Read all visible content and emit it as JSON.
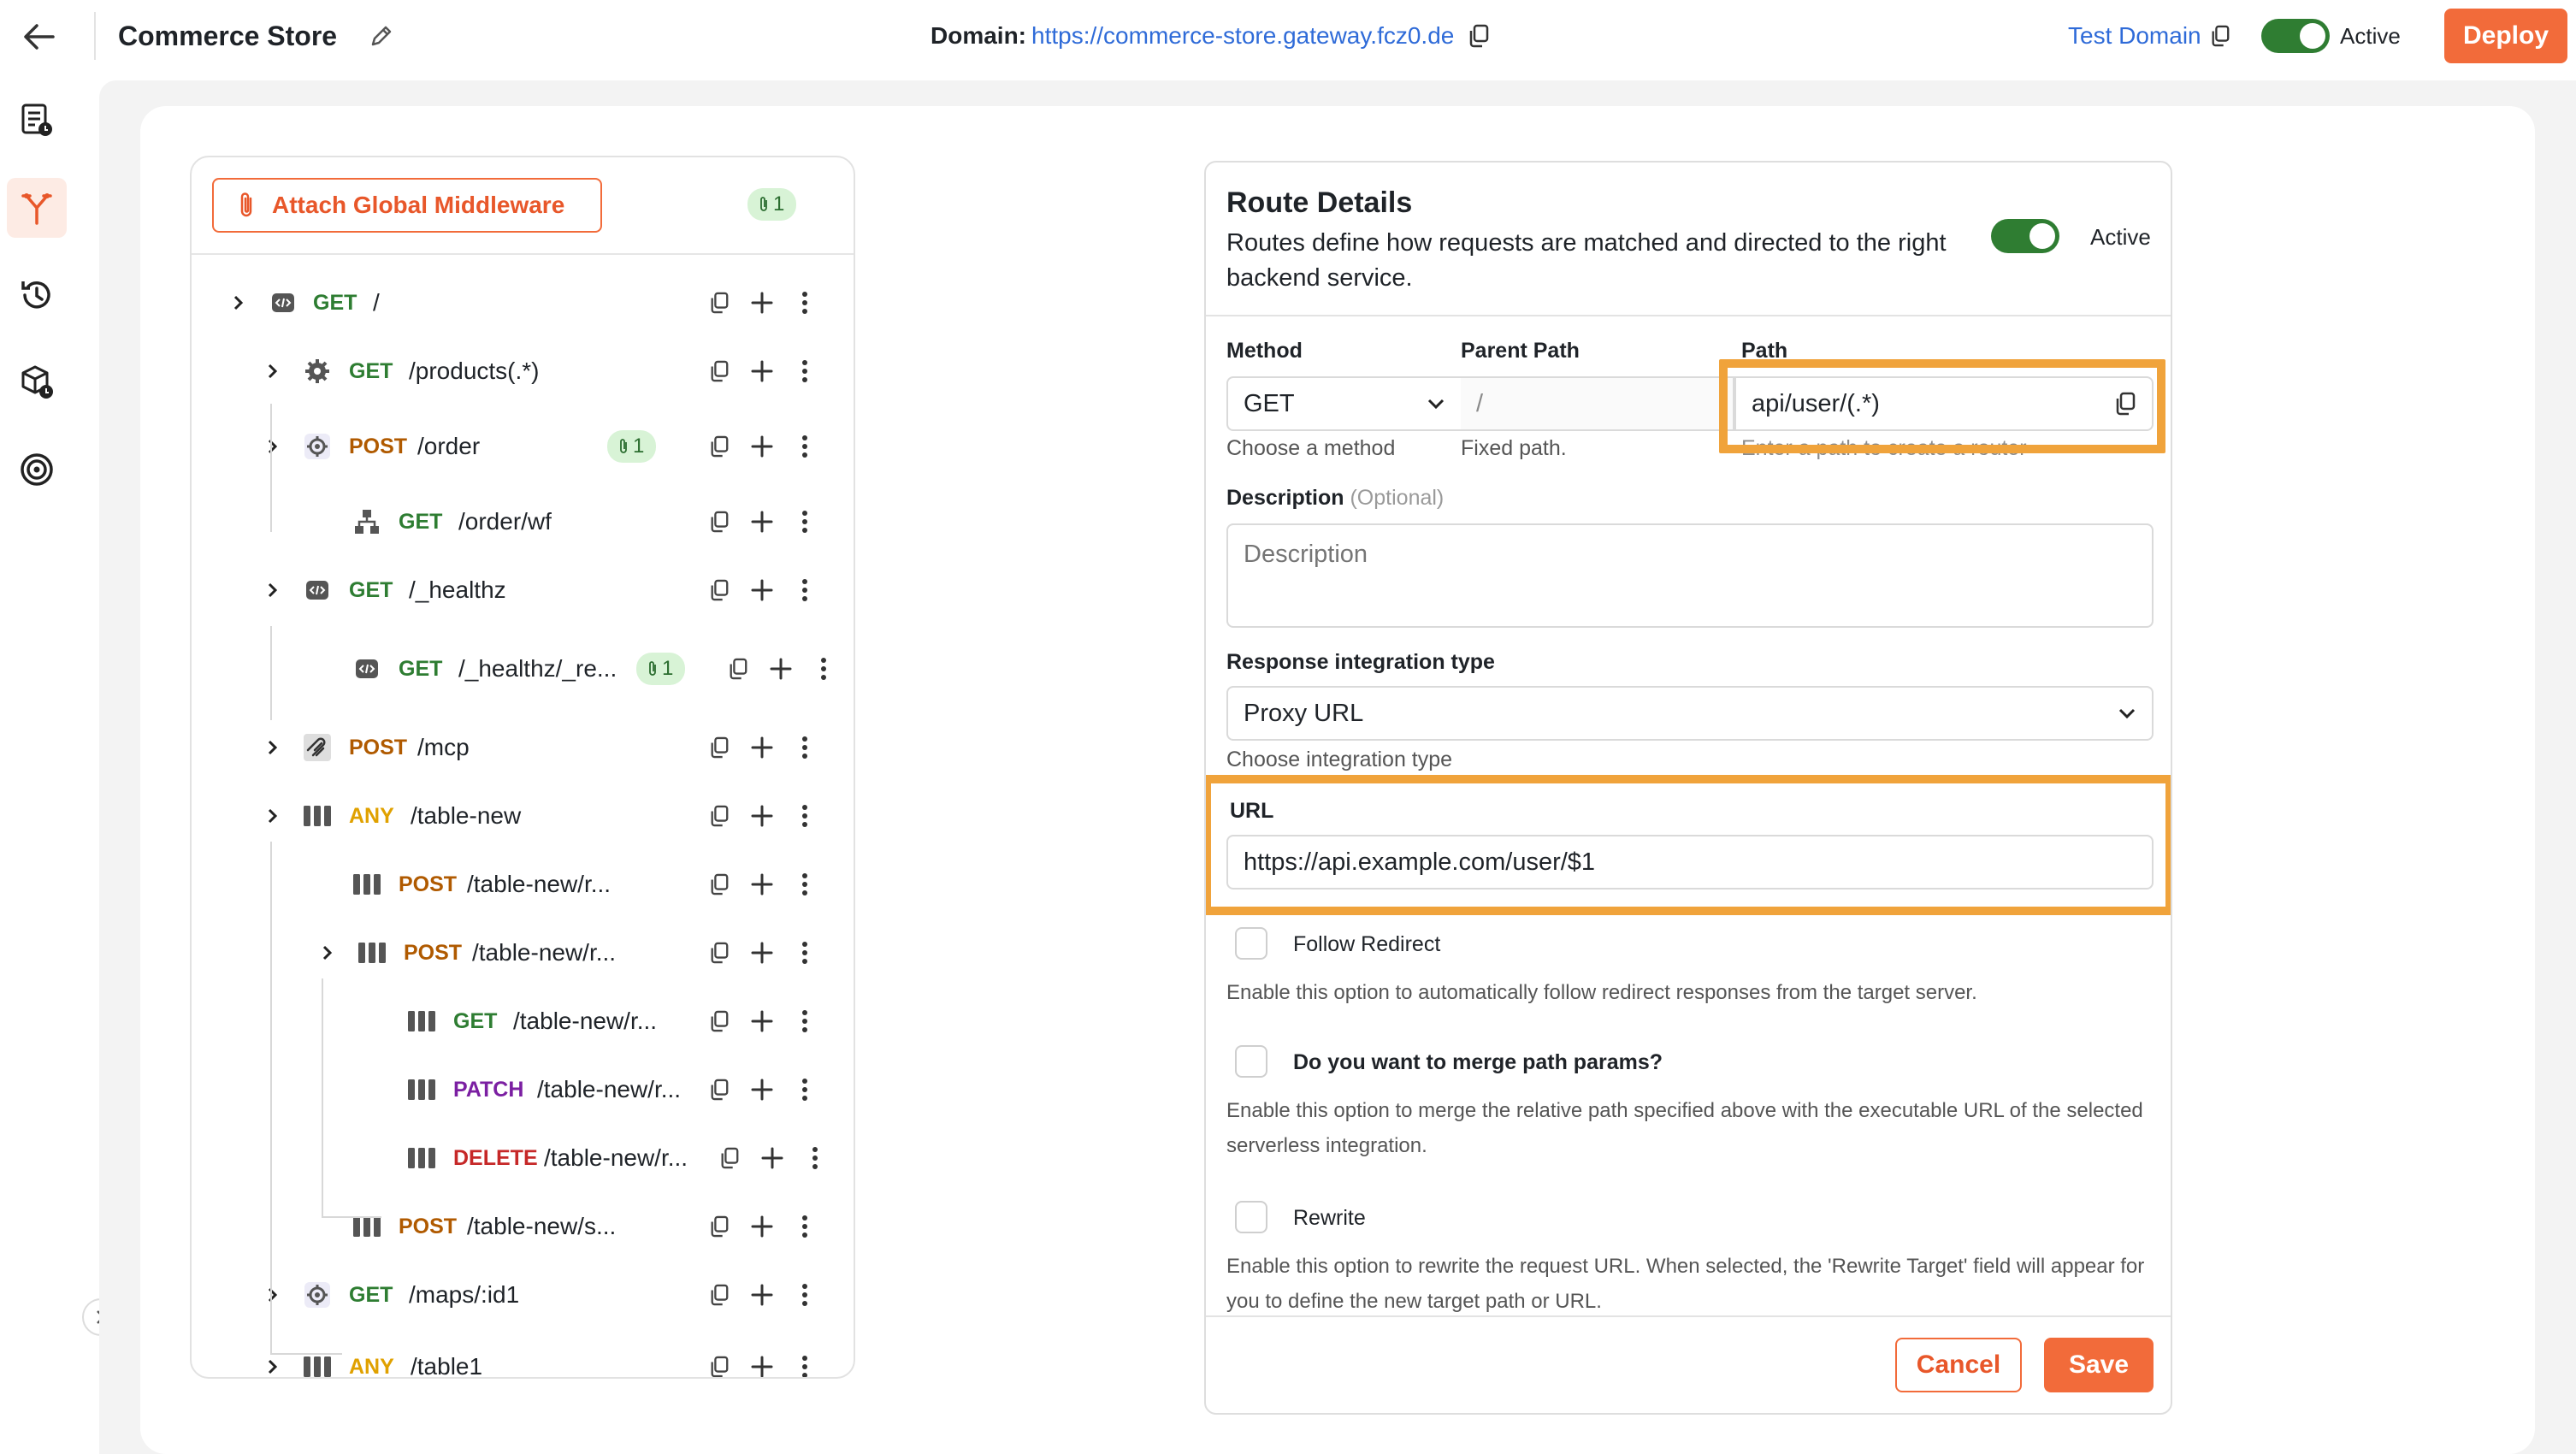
{
  "header": {
    "title": "Commerce Store",
    "domain_label": "Domain:",
    "domain_url": "https://commerce-store.gateway.fcz0.de",
    "test_domain": "Test Domain",
    "active_label": "Active",
    "deploy_label": "Deploy"
  },
  "sidebar": {
    "items": [
      {
        "icon": "document-clock-icon"
      },
      {
        "icon": "routes-icon",
        "active": true
      },
      {
        "icon": "history-icon"
      },
      {
        "icon": "package-clock-icon"
      },
      {
        "icon": "target-icon"
      }
    ]
  },
  "tree": {
    "attach_label": "Attach Global Middleware",
    "global_mw_count": "1",
    "routes": [
      {
        "method": "GET",
        "path": "/",
        "icon": "code-icon",
        "expandable": true
      },
      {
        "method": "GET",
        "path": "/products(.*)",
        "icon": "gear-icon",
        "expandable": true
      },
      {
        "method": "POST",
        "path": "/order",
        "icon": "gear-outline-icon",
        "expandable": true,
        "mw": "1"
      },
      {
        "method": "GET",
        "path": "/order/wf",
        "icon": "workflow-icon",
        "expandable": false
      },
      {
        "method": "GET",
        "path": "/_healthz",
        "icon": "code-icon",
        "expandable": true
      },
      {
        "method": "GET",
        "path": "/_healthz/_re...",
        "icon": "code-icon",
        "expandable": false,
        "mw": "1"
      },
      {
        "method": "POST",
        "path": "/mcp",
        "icon": "mcp-icon",
        "expandable": true
      },
      {
        "method": "ANY",
        "path": "/table-new",
        "icon": "table-icon",
        "expandable": true
      },
      {
        "method": "POST",
        "path": "/table-new/r...",
        "icon": "table-icon",
        "expandable": false
      },
      {
        "method": "POST",
        "path": "/table-new/r...",
        "icon": "table-icon",
        "expandable": true
      },
      {
        "method": "GET",
        "path": "/table-new/r...",
        "icon": "table-icon",
        "expandable": false
      },
      {
        "method": "PATCH",
        "path": "/table-new/r...",
        "icon": "table-icon",
        "expandable": false
      },
      {
        "method": "DELETE",
        "path": "/table-new/r...",
        "icon": "table-icon",
        "expandable": false
      },
      {
        "method": "POST",
        "path": "/table-new/s...",
        "icon": "table-icon",
        "expandable": false
      },
      {
        "method": "GET",
        "path": "/maps/:id1",
        "icon": "gear-outline-icon",
        "expandable": true
      },
      {
        "method": "ANY",
        "path": "/table1",
        "icon": "table-icon",
        "expandable": true
      }
    ]
  },
  "route": {
    "title": "Route Details",
    "subtitle": "Routes define how requests are matched and directed to the right backend service.",
    "active_label": "Active",
    "method_label": "Method",
    "method_value": "GET",
    "method_hint": "Choose a method",
    "parent_label": "Parent Path",
    "parent_value": "/",
    "parent_hint": "Fixed path.",
    "path_label": "Path",
    "path_value": "api/user/(.*)",
    "path_hint": "Enter a path to create a router",
    "desc_label": "Description",
    "desc_optional": "(Optional)",
    "desc_placeholder": "Description",
    "integration_label": "Response integration type",
    "integration_value": "Proxy URL",
    "integration_hint": "Choose integration type",
    "url_label": "URL",
    "url_value": "https://api.example.com/user/$1",
    "follow_label": "Follow Redirect",
    "follow_desc": "Enable this option to automatically follow redirect responses from the target server.",
    "merge_label": "Do you want to merge path params?",
    "merge_desc": "Enable this option to merge the relative path specified above with the executable URL of the selected serverless integration.",
    "rewrite_label": "Rewrite",
    "rewrite_desc": "Enable this option to rewrite the request URL. When selected, the 'Rewrite Target' field will appear for you to define the new target path or URL.",
    "cancel_label": "Cancel",
    "save_label": "Save"
  },
  "colors": {
    "accent": "#f26b3a",
    "toggle_on": "#2f7d32",
    "link": "#2f6bd8",
    "highlight": "#f0a33b"
  }
}
